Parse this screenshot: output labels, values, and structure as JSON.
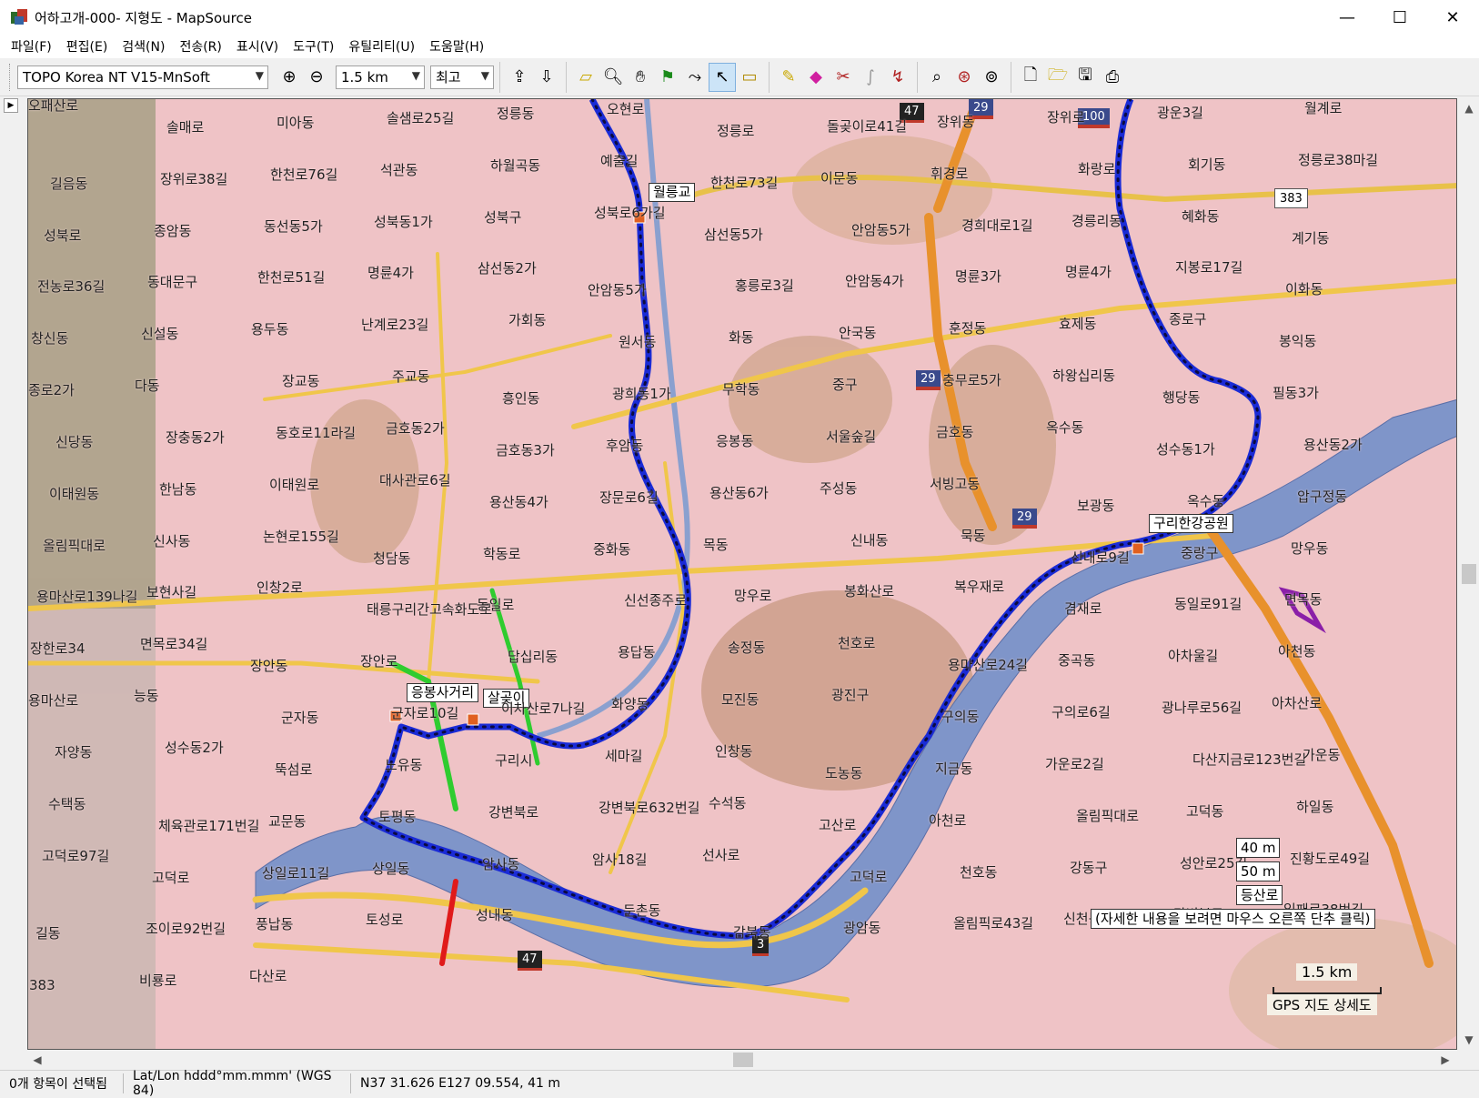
{
  "window": {
    "title": "어하고개-000- 지형도 - MapSource",
    "minimize": "—",
    "maximize": "☐",
    "close": "✕"
  },
  "menu": [
    {
      "id": "file",
      "label": "파일(F)"
    },
    {
      "id": "edit",
      "label": "편집(E)"
    },
    {
      "id": "search",
      "label": "검색(N)"
    },
    {
      "id": "transfer",
      "label": "전송(R)"
    },
    {
      "id": "view",
      "label": "표시(V)"
    },
    {
      "id": "tools",
      "label": "도구(T)"
    },
    {
      "id": "utility",
      "label": "유틸리티(U)"
    },
    {
      "id": "help",
      "label": "도움말(H)"
    }
  ],
  "toolbar": {
    "map_product": "TOPO Korea NT V15-MnSoft",
    "zoom_scale": "1.5 km",
    "detail_level": "최고",
    "icons": [
      "zoom-in-icon",
      "zoom-out-icon",
      "receive-from-device-icon",
      "send-to-device-icon",
      "select-region-icon",
      "zoom-tool-icon",
      "hand-tool-icon",
      "waypoint-tool-icon",
      "route-tool-icon",
      "selection-tool-icon",
      "measure-tool-icon",
      "track-draw-icon",
      "eraser-icon",
      "track-split-icon",
      "track-join-icon",
      "route-calc-icon",
      "find-icon",
      "find-nearest-icon",
      "find-places-icon",
      "new-file-icon",
      "open-file-icon",
      "save-file-icon",
      "print-icon"
    ]
  },
  "map": {
    "colors": {
      "background": "#efc3c6",
      "water": "#7f95c9",
      "track": "#1a2bd6",
      "highway": "#e8912c",
      "road": "#f0c64a"
    },
    "poi_labels": [
      {
        "id": "poi-wolleunggyo",
        "text": "월릉교"
      },
      {
        "id": "poi-guri-hangang-park",
        "text": "구리한강공원"
      },
      {
        "id": "poi-eungbongsa",
        "text": "응봉사거리"
      },
      {
        "id": "poi-salgoji",
        "text": "살곶이"
      }
    ],
    "route_shields": [
      {
        "id": "route-47-top",
        "text": "47"
      },
      {
        "id": "route-29-top",
        "text": "29"
      },
      {
        "id": "route-100",
        "text": "100"
      },
      {
        "id": "route-29-mid",
        "text": "29"
      },
      {
        "id": "route-29-low",
        "text": "29"
      },
      {
        "id": "route-383",
        "text": "383"
      },
      {
        "id": "route-3",
        "text": "3"
      },
      {
        "id": "route-47-bottom",
        "text": "47"
      }
    ],
    "place_labels": [
      "오패산로",
      "솔매로",
      "미아동",
      "솔샘로25길",
      "정릉동",
      "오현로",
      "정릉로",
      "돌곶이로41길",
      "장위동",
      "장위로",
      "광운3길",
      "월계로",
      "길음동",
      "장위로38길",
      "한천로76길",
      "석관동",
      "하월곡동",
      "예출길",
      "한천로73길",
      "이문동",
      "휘경로",
      "화랑로",
      "회기동",
      "정릉로38마길",
      "성북로",
      "종암동",
      "동선동5가",
      "성북동1가",
      "성북구",
      "성북로6가길",
      "삼선동5가",
      "안암동5가",
      "경희대로1길",
      "경릉리동",
      "혜화동",
      "계기동",
      "전농로36길",
      "동대문구",
      "한천로51길",
      "명륜4가",
      "삼선동2가",
      "안암동5가",
      "홍릉로3길",
      "안암동4가",
      "명륜3가",
      "명륜4가",
      "지봉로17길",
      "이화동",
      "창신동",
      "신설동",
      "용두동",
      "난계로23길",
      "가회동",
      "원서동",
      "화동",
      "안국동",
      "훈정동",
      "효제동",
      "종로구",
      "봉익동",
      "종로2가",
      "다동",
      "장교동",
      "주교동",
      "흥인동",
      "광희동1가",
      "무학동",
      "중구",
      "충무로5가",
      "하왕십리동",
      "행당동",
      "필동3가",
      "신당동",
      "장충동2가",
      "동호로11라길",
      "금호동2가",
      "금호동3가",
      "후암동",
      "응봉동",
      "서울숲길",
      "금호동",
      "옥수동",
      "성수동1가",
      "용산동2가",
      "이태원동",
      "한남동",
      "이태원로",
      "대사관로6길",
      "용산동4가",
      "장문로6길",
      "용산동6가",
      "주성동",
      "서빙고동",
      "보광동",
      "옥수동",
      "압구정동",
      "올림픽대로",
      "신사동",
      "논현로155길",
      "청담동",
      "학동로",
      "중화동",
      "목동",
      "신내동",
      "묵동",
      "신내로9길",
      "중랑구",
      "망우동",
      "용마산로139나길",
      "보현사길",
      "인창2로",
      "태릉구리간고속화도로",
      "동일로",
      "신선종주로",
      "망우로",
      "봉화산로",
      "복우재로",
      "겸재로",
      "동일로91길",
      "면목동",
      "장한로34",
      "면목로34길",
      "장안동",
      "장안로",
      "답십리동",
      "용답동",
      "송정동",
      "천호로",
      "용마산로24길",
      "중곡동",
      "아차울길",
      "아천동",
      "용마산로",
      "능동",
      "군자동",
      "군자로10길",
      "이차산로7나길",
      "화양동",
      "모진동",
      "광진구",
      "구의동",
      "구의로6길",
      "광나루로56길",
      "아차산로",
      "자양동",
      "성수동2가",
      "뚝섬로",
      "노유동",
      "구리시",
      "세마길",
      "인창동",
      "도농동",
      "지금동",
      "가운로2길",
      "다산지금로123번길",
      "가운동",
      "수택동",
      "체육관로171번길",
      "교문동",
      "토평동",
      "강변북로",
      "강변북로632번길",
      "수석동",
      "고산로",
      "아천로",
      "올림픽대로",
      "고덕동",
      "하일동",
      "고덕로97길",
      "고덕로",
      "상일로11길",
      "상일동",
      "암사동",
      "암사18길",
      "선사로",
      "고덕로",
      "천호동",
      "강동구",
      "성안로25길",
      "진황도로49길",
      "길동",
      "조이로92번길",
      "풍납동",
      "토성로",
      "성내동",
      "둔촌동",
      "감북동",
      "광암동",
      "올림픽로43길",
      "신천동",
      "강변북로",
      "일패로38번길",
      "383",
      "비룡로",
      "다산로"
    ],
    "info_boxes": {
      "contour_40": "40 m",
      "contour_50": "50 m",
      "trail": "등산로",
      "hint": "(자세한 내용을 보려면 마우스 오른쪽 단추 클릭)"
    },
    "scale_bar": "1.5 km",
    "map_detail_label": "GPS 지도 상세도"
  },
  "status": {
    "selection": "0개 항목이 선택됨",
    "coord_format": "Lat/Lon hddd°mm.mmm' (WGS 84)",
    "cursor_position": "N37 31.626 E127 09.554, 41 m"
  }
}
